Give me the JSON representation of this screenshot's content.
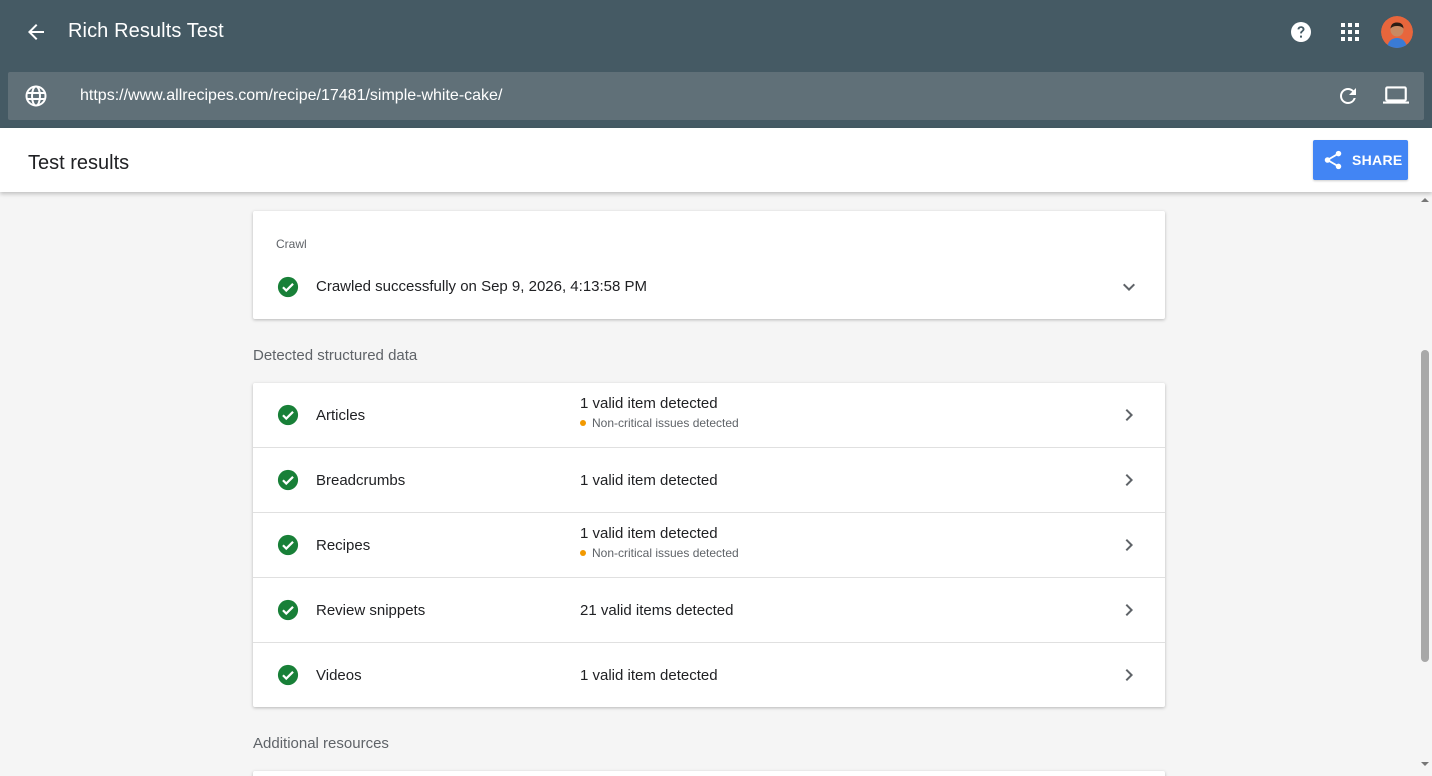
{
  "header": {
    "title": "Rich Results Test",
    "url_value": "https://www.allrecipes.com/recipe/17481/simple-white-cake/",
    "icons": [
      "back-arrow-icon",
      "help-icon",
      "apps-grid-icon",
      "globe-icon",
      "reload-icon",
      "desktop-device-icon"
    ]
  },
  "results": {
    "title": "Test results",
    "share_label": "SHARE"
  },
  "crawl": {
    "label": "Crawl",
    "status": "Crawled successfully on Sep 9, 2026, 4:13:58 PM"
  },
  "structured_data": {
    "title": "Detected structured data",
    "items": [
      {
        "name": "Articles",
        "status": "1 valid item detected",
        "warning": "Non-critical issues detected"
      },
      {
        "name": "Breadcrumbs",
        "status": "1 valid item detected",
        "warning": ""
      },
      {
        "name": "Recipes",
        "status": "1 valid item detected",
        "warning": "Non-critical issues detected"
      },
      {
        "name": "Review snippets",
        "status": "21 valid items detected",
        "warning": ""
      },
      {
        "name": "Videos",
        "status": "1 valid item detected",
        "warning": ""
      }
    ]
  },
  "additional": {
    "title": "Additional resources"
  },
  "colors": {
    "appbar": "#455a64",
    "urlbar": "#607078",
    "accent": "#4285f4",
    "success": "#188038",
    "warning": "#f29900"
  }
}
